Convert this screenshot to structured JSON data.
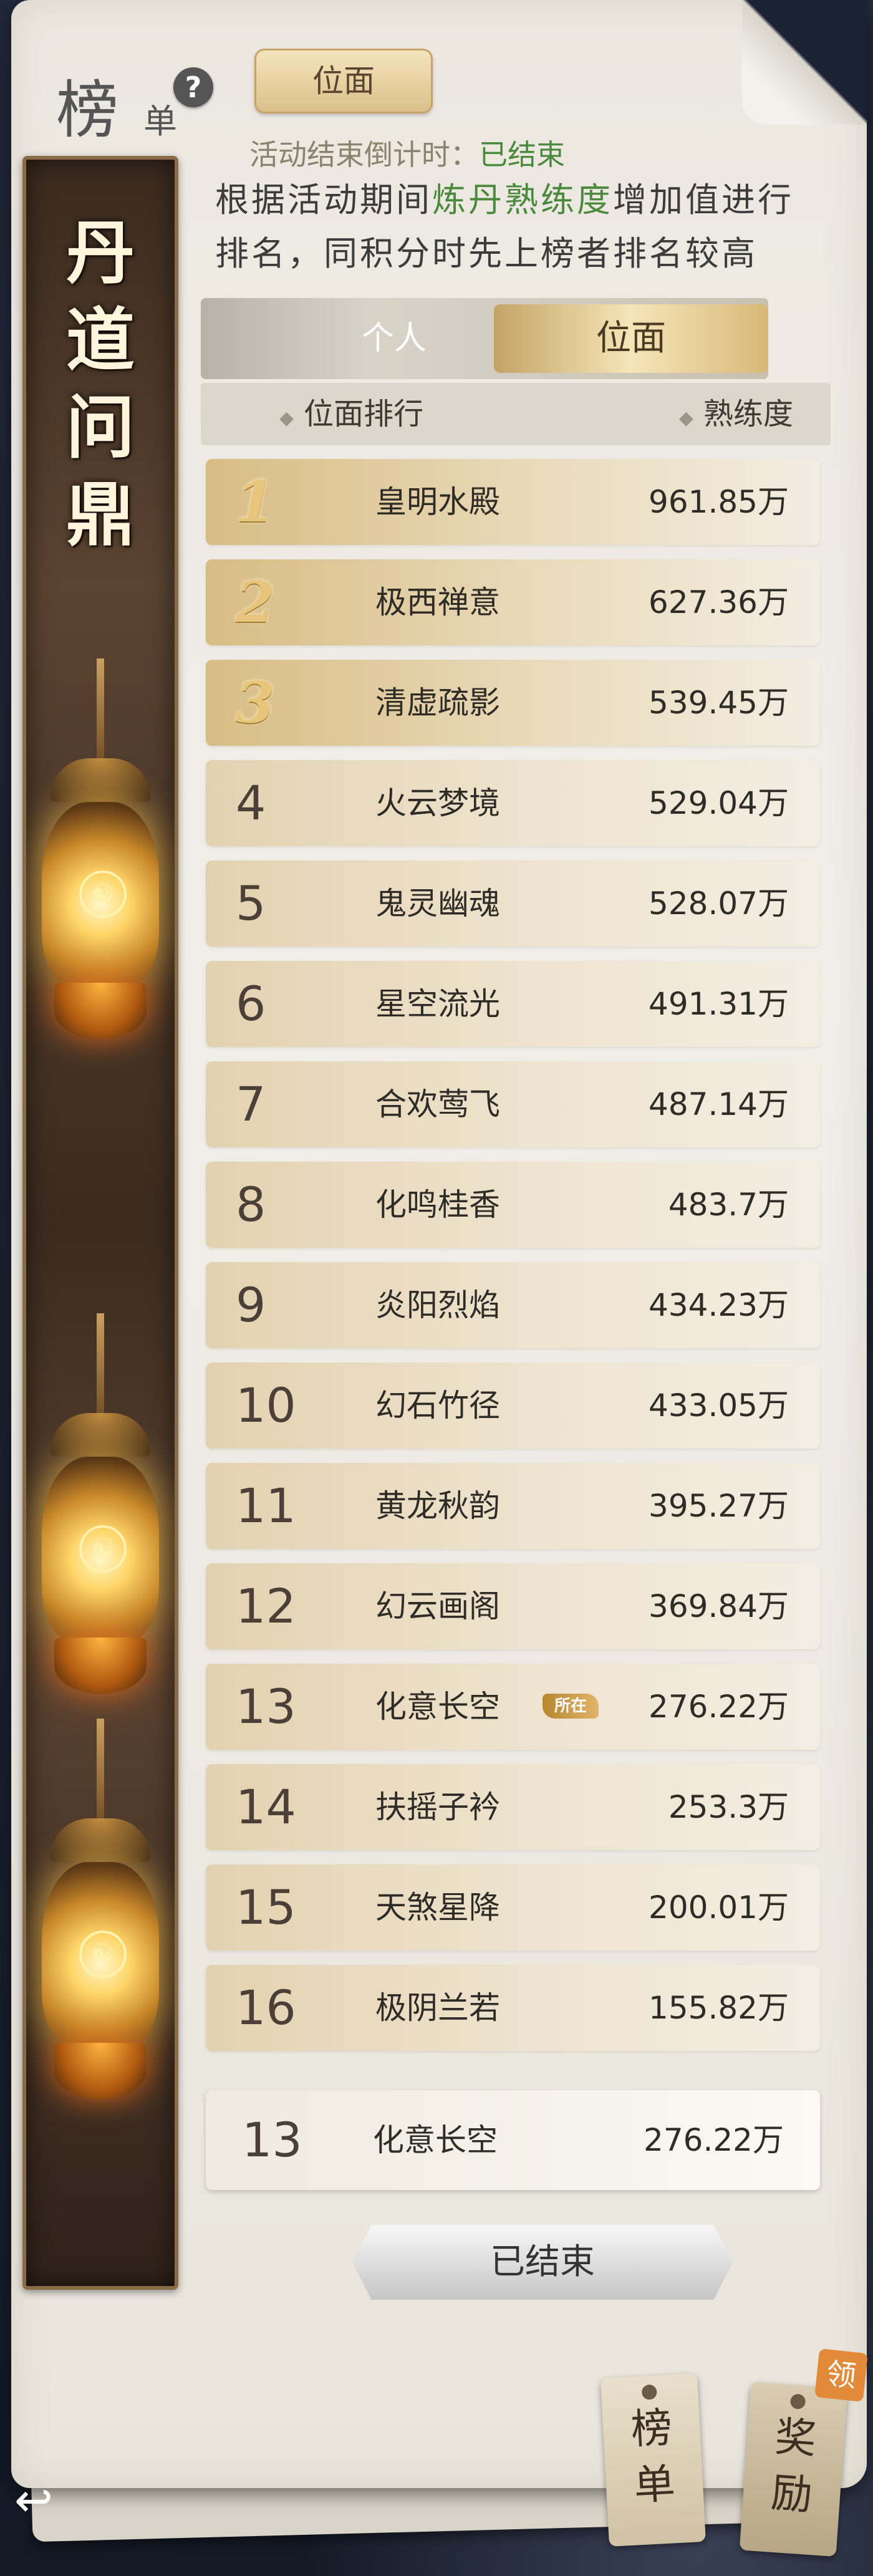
{
  "header": {
    "title_char": "榜",
    "title_sub": "单",
    "help": "?",
    "tab_label": "位面"
  },
  "countdown": {
    "label": "活动结束倒计时：",
    "value": "已结束"
  },
  "description": {
    "part1": "根据活动期间",
    "highlight": "炼丹熟练度",
    "part2": "增加值进行排名，同积分时先上榜者排名较高"
  },
  "banner": {
    "chars": [
      "丹",
      "道",
      "问",
      "鼎"
    ]
  },
  "segment_tabs": [
    {
      "label": "个人"
    },
    {
      "label": "位面"
    }
  ],
  "columns": {
    "rank": "位面排行",
    "score": "熟练度"
  },
  "rows": [
    {
      "rank": "1",
      "name": "皇明水殿",
      "score": "961.85万"
    },
    {
      "rank": "2",
      "name": "极西禅意",
      "score": "627.36万"
    },
    {
      "rank": "3",
      "name": "清虚疏影",
      "score": "539.45万"
    },
    {
      "rank": "4",
      "name": "火云梦境",
      "score": "529.04万"
    },
    {
      "rank": "5",
      "name": "鬼灵幽魂",
      "score": "528.07万"
    },
    {
      "rank": "6",
      "name": "星空流光",
      "score": "491.31万"
    },
    {
      "rank": "7",
      "name": "合欢莺飞",
      "score": "487.14万"
    },
    {
      "rank": "8",
      "name": "化鸣桂香",
      "score": "483.7万"
    },
    {
      "rank": "9",
      "name": "炎阳烈焰",
      "score": "434.23万"
    },
    {
      "rank": "10",
      "name": "幻石竹径",
      "score": "433.05万"
    },
    {
      "rank": "11",
      "name": "黄龙秋韵",
      "score": "395.27万"
    },
    {
      "rank": "12",
      "name": "幻云画阁",
      "score": "369.84万"
    },
    {
      "rank": "13",
      "name": "化意长空",
      "score": "276.22万",
      "badge": "所在"
    },
    {
      "rank": "14",
      "name": "扶摇子衿",
      "score": "253.3万"
    },
    {
      "rank": "15",
      "name": "天煞星降",
      "score": "200.01万"
    },
    {
      "rank": "16",
      "name": "极阴兰若",
      "score": "155.82万"
    }
  ],
  "my_rank": {
    "rank": "13",
    "name": "化意长空",
    "score": "276.22万"
  },
  "ended_button": "已结束",
  "bottom_tags": {
    "rank": "榜单",
    "reward": "奖励",
    "reward_badge": "领"
  },
  "icons": {
    "help": "question-icon",
    "back": "back-arrow-icon",
    "diamond": "diamond-icon"
  },
  "colors": {
    "highlight": "#4b8a3e",
    "gold": "#e7c67c",
    "badge": "#c9974a"
  }
}
